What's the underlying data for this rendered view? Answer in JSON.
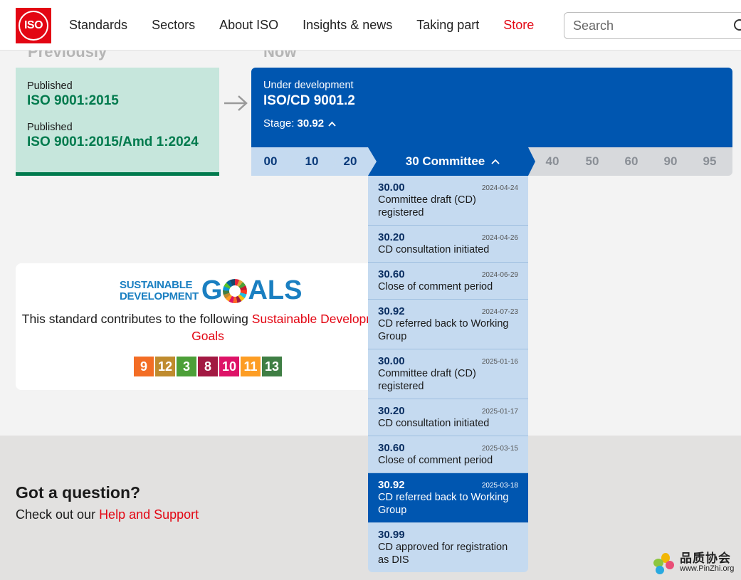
{
  "header": {
    "logo_text": "ISO",
    "nav": [
      "Standards",
      "Sectors",
      "About ISO",
      "Insights & news",
      "Taking part",
      "Store"
    ],
    "search_placeholder": "Search"
  },
  "lifecycle": {
    "previously_heading": "Previously",
    "now_heading": "Now",
    "previous": [
      {
        "label": "Published",
        "ref": "ISO 9001:2015"
      },
      {
        "label": "Published",
        "ref": "ISO 9001:2015/Amd 1:2024"
      }
    ],
    "current": {
      "label": "Under development",
      "ref": "ISO/CD 9001.2",
      "stage_label": "Stage:",
      "stage_value": "30.92"
    },
    "stages": [
      {
        "code": "00",
        "status": "done"
      },
      {
        "code": "10",
        "status": "done"
      },
      {
        "code": "20",
        "status": "done"
      },
      {
        "code": "30 Committee",
        "status": "active"
      },
      {
        "code": "40",
        "status": "future"
      },
      {
        "code": "50",
        "status": "future"
      },
      {
        "code": "60",
        "status": "future"
      },
      {
        "code": "90",
        "status": "future"
      },
      {
        "code": "95",
        "status": "future"
      }
    ],
    "substages": [
      {
        "code": "30.00",
        "date": "2024-04-24",
        "desc": "Committee draft (CD) registered"
      },
      {
        "code": "30.20",
        "date": "2024-04-26",
        "desc": "CD consultation initiated"
      },
      {
        "code": "30.60",
        "date": "2024-06-29",
        "desc": "Close of comment period"
      },
      {
        "code": "30.92",
        "date": "2024-07-23",
        "desc": "CD referred back to Working Group"
      },
      {
        "code": "30.00",
        "date": "2025-01-16",
        "desc": "Committee draft (CD) registered"
      },
      {
        "code": "30.20",
        "date": "2025-01-17",
        "desc": "CD consultation initiated"
      },
      {
        "code": "30.60",
        "date": "2025-03-15",
        "desc": "Close of comment period"
      },
      {
        "code": "30.92",
        "date": "2025-03-18",
        "desc": "CD referred back to Working Group",
        "current": true
      },
      {
        "code": "30.99",
        "date": "",
        "desc": "CD approved for registration as DIS"
      }
    ]
  },
  "sdg": {
    "logo_line1": "SUSTAINABLE",
    "logo_line2": "DEVELOPMENT",
    "logo_g": "G",
    "logo_als": "ALS",
    "text_prefix": "This standard contributes to the following ",
    "text_link": "Sustainable Development Goals",
    "goals": [
      {
        "num": "9",
        "color": "#f36d25"
      },
      {
        "num": "12",
        "color": "#bf8b2e"
      },
      {
        "num": "3",
        "color": "#4c9f38"
      },
      {
        "num": "8",
        "color": "#a21942"
      },
      {
        "num": "10",
        "color": "#dd1367"
      },
      {
        "num": "11",
        "color": "#fd9d24"
      },
      {
        "num": "13",
        "color": "#3f7e44"
      }
    ]
  },
  "footer": {
    "title": "Got a question?",
    "text_prefix": "Check out our ",
    "link": "Help and Support"
  },
  "watermark": {
    "cn": "品质协会",
    "url": "www.PinZhi.org"
  },
  "colors": {
    "iso_red": "#e30613",
    "iso_blue": "#0056b0",
    "published_green": "#007a4d"
  }
}
